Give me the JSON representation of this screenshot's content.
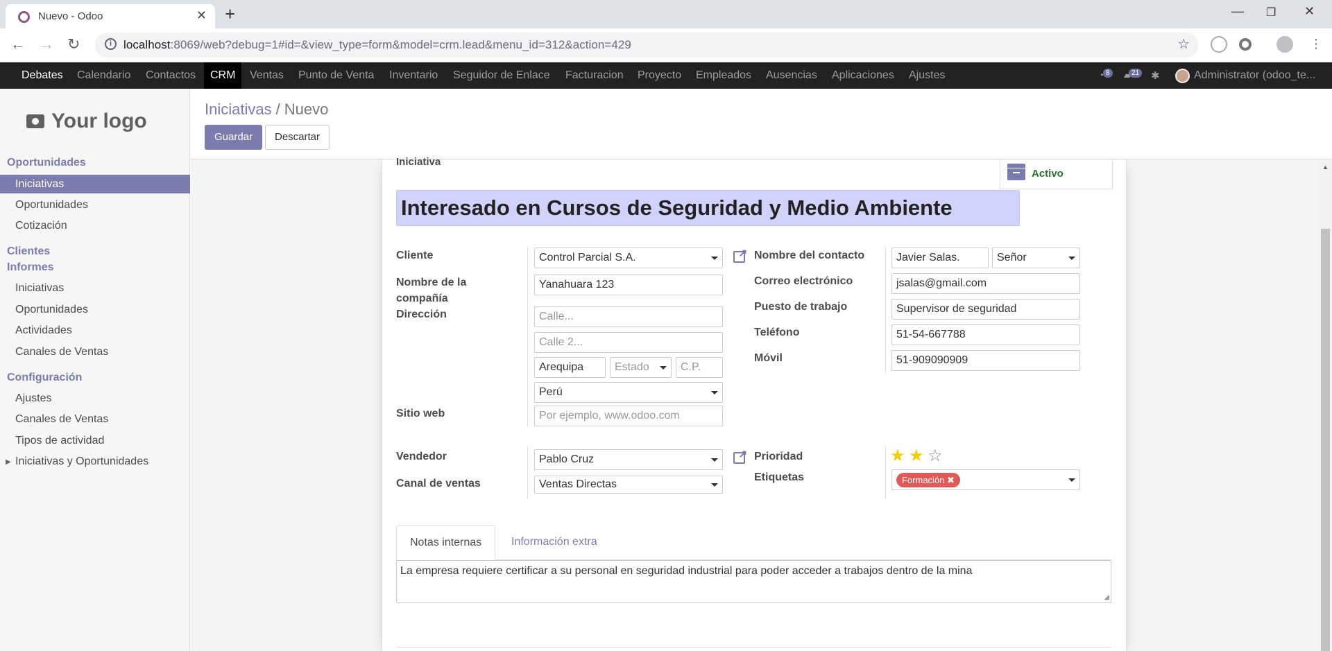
{
  "browser": {
    "tab_title": "Nuevo - Odoo",
    "url_host": "localhost",
    "url_rest": ":8069/web?debug=1#id=&view_type=form&model=crm.lead&menu_id=312&action=429"
  },
  "topmenu": {
    "brand": "Debates",
    "items": [
      "Calendario",
      "Contactos",
      "CRM",
      "Ventas",
      "Punto de Venta",
      "Inventario",
      "Seguidor de Enlace",
      "Facturacion",
      "Proyecto",
      "Empleados",
      "Ausencias",
      "Aplicaciones",
      "Ajustes"
    ],
    "activities_count": "8",
    "messages_count": "21",
    "user": "Administrator (odoo_te..."
  },
  "sidebar": {
    "logo": "Your logo",
    "sections": [
      {
        "title": "Oportunidades",
        "items": [
          "Iniciativas",
          "Oportunidades",
          "Cotización"
        ]
      },
      {
        "title": "Clientes",
        "items": []
      },
      {
        "title": "Informes",
        "items": [
          "Iniciativas",
          "Oportunidades",
          "Actividades",
          "Canales de Ventas"
        ]
      },
      {
        "title": "Configuración",
        "items": [
          "Ajustes",
          "Canales de Ventas",
          "Tipos de actividad",
          "Iniciativas y Oportunidades"
        ]
      }
    ]
  },
  "breadcrumb": {
    "parent": "Iniciativas",
    "separator": "/",
    "current": "Nuevo"
  },
  "buttons": {
    "save": "Guardar",
    "discard": "Descartar"
  },
  "form": {
    "section_label": "Iniciativa",
    "active_button": "Activo",
    "title": "Interesado en Cursos de Seguridad y Medio Ambiente",
    "labels": {
      "cliente": "Cliente",
      "company_name": "Nombre de la compañía",
      "direccion": "Dirección",
      "sitio_web": "Sitio web",
      "contact_name": "Nombre del contacto",
      "email": "Correo electrónico",
      "job": "Puesto de trabajo",
      "phone": "Teléfono",
      "mobile": "Móvil",
      "vendedor": "Vendedor",
      "canal": "Canal de ventas",
      "prioridad": "Prioridad",
      "etiquetas": "Etiquetas"
    },
    "values": {
      "cliente": "Control Parcial S.A.",
      "company_name": "Yanahuara 123",
      "city": "Arequipa",
      "country": "Perú",
      "contact_name": "Javier Salas.",
      "title": "Señor",
      "email": "jsalas@gmail.com",
      "job": "Supervisor de seguridad",
      "phone": "51-54-667788",
      "mobile": "51-909090909",
      "vendedor": "Pablo Cruz",
      "canal": "Ventas Directas",
      "priority_stars": 2,
      "priority_max": 3,
      "tag": "Formación"
    },
    "placeholders": {
      "street": "Calle...",
      "street2": "Calle 2...",
      "state": "Estado",
      "zip": "C.P.",
      "website": "Por ejemplo, www.odoo.com"
    },
    "tabs": [
      "Notas internas",
      "Información extra"
    ],
    "notes": "La empresa requiere certificar a su personal en seguridad industrial para poder acceder a trabajos dentro de la mina"
  }
}
